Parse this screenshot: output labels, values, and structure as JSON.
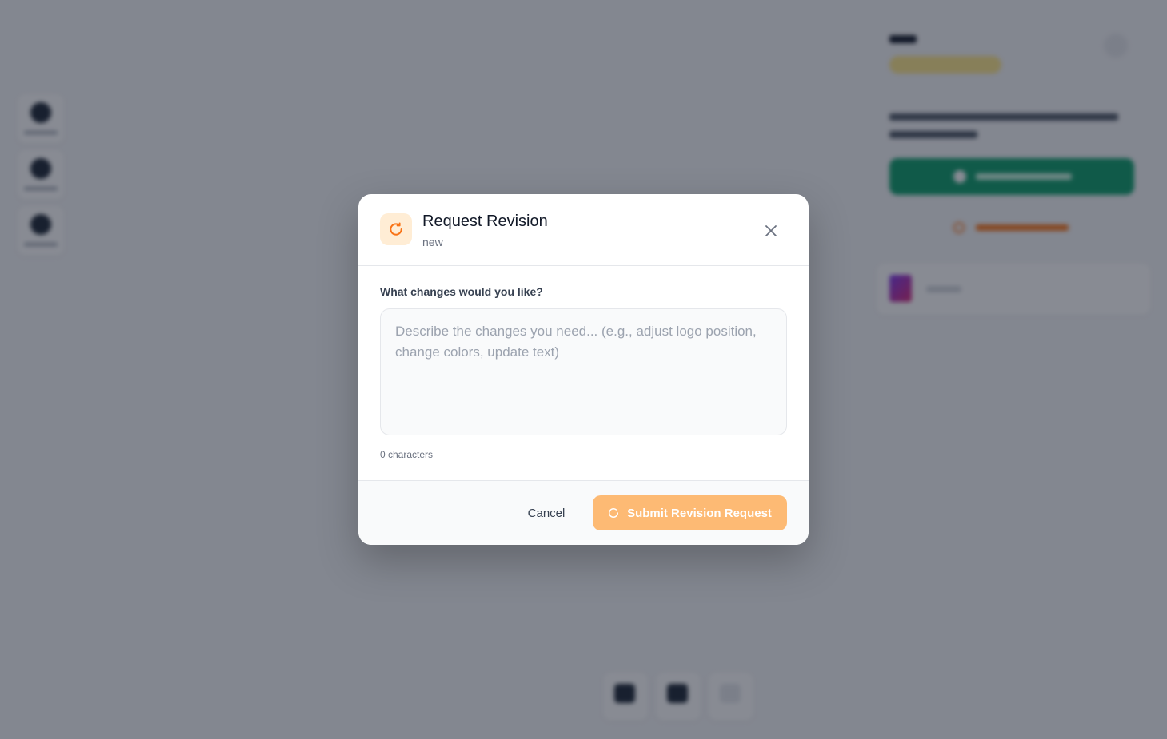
{
  "modal": {
    "title": "Request Revision",
    "subtitle": "new",
    "icon": "refresh-icon",
    "field_label": "What changes would you like?",
    "textarea": {
      "value": "",
      "placeholder": "Describe the changes you need... (e.g., adjust logo position, change colors, update text)"
    },
    "char_count": "0 characters",
    "cancel_label": "Cancel",
    "submit_label": "Submit Revision Request",
    "submit_icon": "refresh-icon",
    "close_icon": "close-icon"
  },
  "colors": {
    "accent": "#f97316",
    "accent_light": "#ffedd5",
    "submit_disabled": "#fdba74",
    "overlay": "#6b7280",
    "approve_green": "#0f9d6b"
  }
}
